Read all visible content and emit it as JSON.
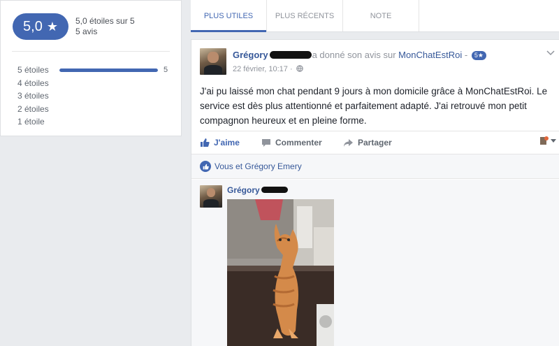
{
  "rating": {
    "score": "5,0",
    "star": "★",
    "summary": "5,0 étoiles sur 5",
    "count": "5 avis",
    "distribution": [
      {
        "label": "5 étoiles",
        "fraction": 1.0,
        "count": "5"
      },
      {
        "label": "4 étoiles",
        "fraction": 0,
        "count": ""
      },
      {
        "label": "3 étoiles",
        "fraction": 0,
        "count": ""
      },
      {
        "label": "2 étoiles",
        "fraction": 0,
        "count": ""
      },
      {
        "label": "1 étoile",
        "fraction": 0,
        "count": ""
      }
    ]
  },
  "tabs": [
    "PLUS UTILES",
    "PLUS RÉCENTS",
    "NOTE"
  ],
  "post": {
    "author": "Grégory",
    "action": "a donné son avis sur",
    "page": "MonChatEstRoi",
    "separator": "-",
    "badge": "5★",
    "time": "22 février, 10:17 ·",
    "globe_icon": "globe-icon",
    "text": "J'ai pu laissé mon chat pendant 9 jours à mon domicile grâce à MonChatEstRoi. Le service est dès plus attentionné et parfaitement adapté. J'ai retrouvé mon petit compagnon heureux et en pleine forme.",
    "actions": {
      "like": "J'aime",
      "comment": "Commenter",
      "share": "Partager"
    },
    "likes_text": "Vous et Grégory Emery",
    "comment_author": "Grégory"
  },
  "colors": {
    "accent": "#4267b2",
    "link": "#365899",
    "background": "#e9ebee"
  }
}
